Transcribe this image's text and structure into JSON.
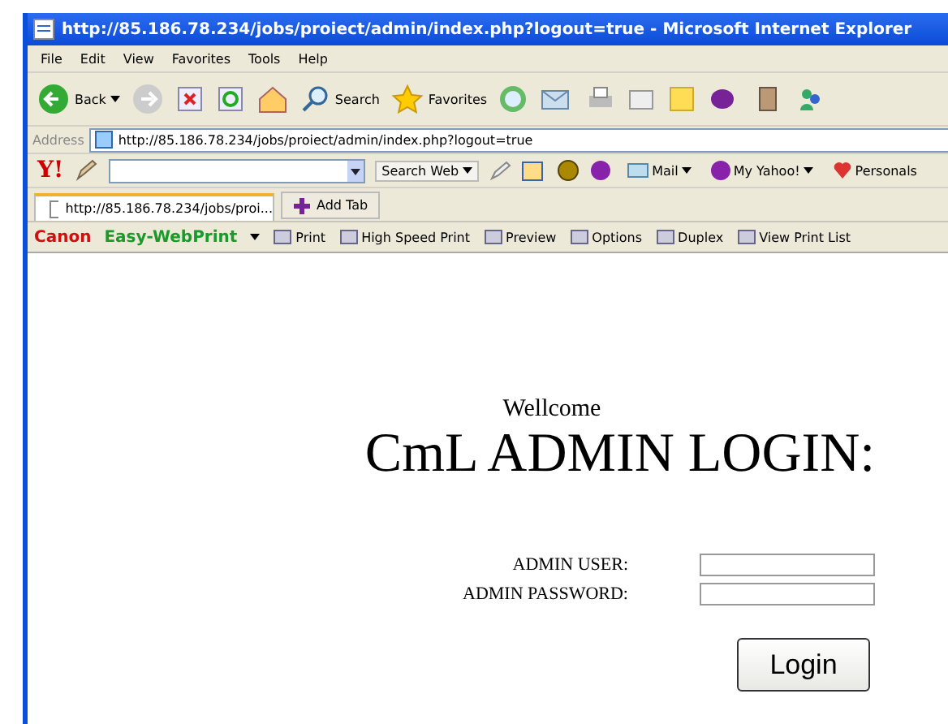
{
  "window": {
    "title": "http://85.186.78.234/jobs/proiect/admin/index.php?logout=true - Microsoft Internet Explorer"
  },
  "menu": [
    "File",
    "Edit",
    "View",
    "Favorites",
    "Tools",
    "Help"
  ],
  "toolbar": {
    "back": "Back",
    "search": "Search",
    "favorites": "Favorites"
  },
  "address": {
    "label": "Address",
    "value": "http://85.186.78.234/jobs/proiect/admin/index.php?logout=true"
  },
  "yahoo_bar": {
    "logo": "Y!",
    "search_button": "Search Web",
    "mail": "Mail",
    "my_yahoo": "My Yahoo!",
    "personals": "Personals"
  },
  "tabs": [
    {
      "label": "http://85.186.78.234/jobs/proi...",
      "selected": true
    }
  ],
  "add_tab": "Add Tab",
  "print_bar": {
    "brand": "Canon",
    "product": "Easy-WebPrint",
    "items": [
      "Print",
      "High Speed Print",
      "Preview",
      "Options",
      "Duplex",
      "View Print List"
    ]
  },
  "page": {
    "greeting": "Wellcome",
    "heading": "CmL ADMIN LOGIN:",
    "fields": [
      {
        "label": "ADMIN USER:"
      },
      {
        "label": "ADMIN PASSWORD:"
      }
    ],
    "button": "Login"
  }
}
